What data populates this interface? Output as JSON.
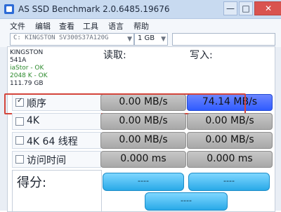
{
  "window": {
    "title": "AS SSD Benchmark 2.0.6485.19676",
    "controls": {
      "minimize": "—",
      "maximize": "□",
      "close": "✕"
    }
  },
  "menu": [
    "文件",
    "编辑",
    "查看",
    "工具",
    "语言",
    "帮助"
  ],
  "toolbar": {
    "drive_selected": "C: KINGSTON SV300S37A120G",
    "size_selected": "1 GB",
    "aux_value": ""
  },
  "drive_info": {
    "model": "KINGSTON",
    "firmware": "541A",
    "driver_status": "iaStor - OK",
    "alignment": "2048 K - OK",
    "capacity": "111.79 GB"
  },
  "headers": {
    "read": "读取:",
    "write": "写入:"
  },
  "rows": [
    {
      "label": "顺序",
      "checked": true,
      "read": "0.00 MB/s",
      "write": "74.14 MB/s"
    },
    {
      "label": "4K",
      "checked": false,
      "read": "0.00 MB/s",
      "write": "0.00 MB/s"
    },
    {
      "label": "4K 64 线程",
      "checked": false,
      "read": "0.00 MB/s",
      "write": "0.00 MB/s"
    },
    {
      "label": "访问时间",
      "checked": false,
      "read": "0.000 ms",
      "write": "0.000 ms"
    }
  ],
  "score": {
    "label": "得分:",
    "read": "----",
    "write": "----",
    "total": "----"
  },
  "colors": {
    "accent_blue": "#2f5bff",
    "highlight_red": "#d4453b",
    "score_cyan": "#29a9e8"
  }
}
